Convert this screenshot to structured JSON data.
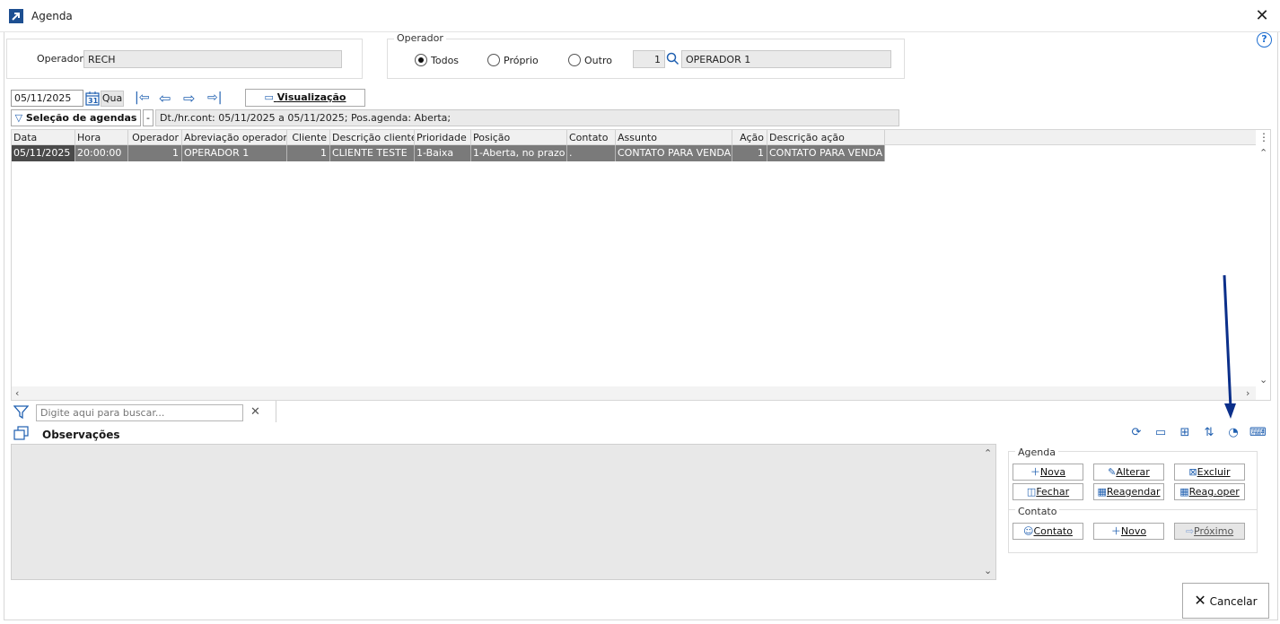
{
  "window": {
    "title": "Agenda",
    "help": "?"
  },
  "operador_panel": {
    "label": "Operador",
    "value": "RECH"
  },
  "operador_group": {
    "legend": "Operador",
    "options": [
      "Todos",
      "Próprio",
      "Outro"
    ],
    "selected": "Todos",
    "code": "1",
    "name": "OPERADOR 1"
  },
  "date_bar": {
    "date": "05/11/2025",
    "calendar_day": "31",
    "weekday": "Qua",
    "view_button": "Visualização"
  },
  "selection": {
    "button": "Seleção de agendas",
    "dropdown": "-",
    "filter_text": "Dt./hr.cont: 05/11/2025 a 05/11/2025; Pos.agenda: Aberta;"
  },
  "grid": {
    "columns": [
      "Data",
      "Hora",
      "Operador",
      "Abreviação operador",
      "Cliente",
      "Descrição cliente",
      "Prioridade",
      "Posição",
      "Contato",
      "Assunto",
      "Ação",
      "Descrição ação"
    ],
    "rows": [
      [
        "05/11/2025",
        "20:00:00",
        "1",
        "OPERADOR 1",
        "1",
        "CLIENTE TESTE",
        "1-Baixa",
        "1-Aberta, no prazo",
        ".",
        "CONTATO PARA VENDA",
        "1",
        "CONTATO PARA VENDA"
      ]
    ]
  },
  "search": {
    "placeholder": "Digite aqui para buscar..."
  },
  "observacoes": {
    "title": "Observações"
  },
  "agenda_group": {
    "legend": "Agenda",
    "buttons": [
      "Nova",
      "Alterar",
      "Excluir",
      "Fechar",
      "Reagendar",
      "Reag.oper"
    ]
  },
  "contato_group": {
    "legend": "Contato",
    "buttons": [
      "Contato",
      "Novo",
      "Próximo"
    ]
  },
  "footer": {
    "cancel": "Cancelar"
  },
  "colors": {
    "accent": "#1f5fb0",
    "selected_row": "#7a7a7a",
    "arrow": "#0b2f8a"
  }
}
